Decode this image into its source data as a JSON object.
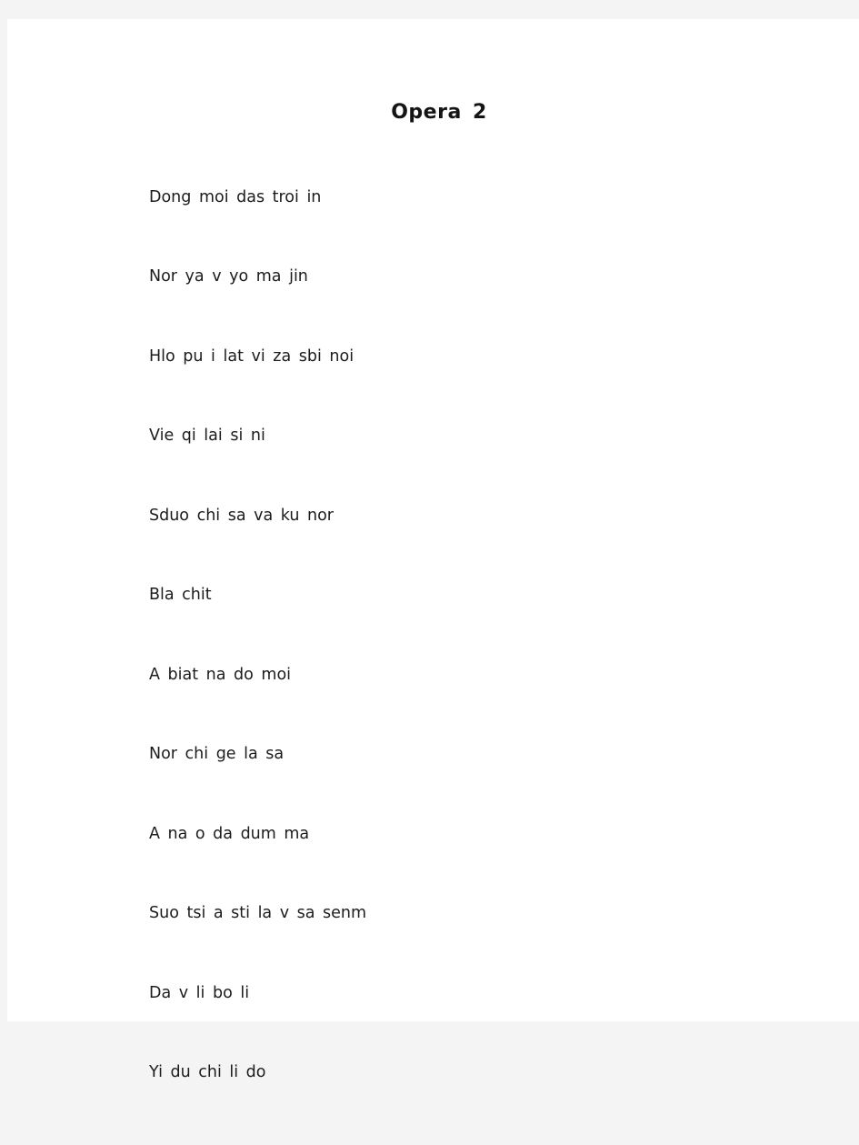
{
  "document": {
    "title": "Opera 2",
    "background_color": "#f4f4f4",
    "page_color": "#ffffff",
    "text_color": "#1c1c1c",
    "lines": [
      "Dong moi das troi in",
      "Nor ya v yo ma jin",
      "Hlo pu i lat vi za sbi noi",
      "Vie qi lai si ni",
      "Sduo chi sa va ku nor",
      "Bla chit",
      "A biat na do moi",
      "Nor chi ge la sa",
      "A na o da dum ma",
      "Suo tsi a sti la v sa senm",
      "Da v li bo li",
      "Yi du chi li do"
    ]
  }
}
